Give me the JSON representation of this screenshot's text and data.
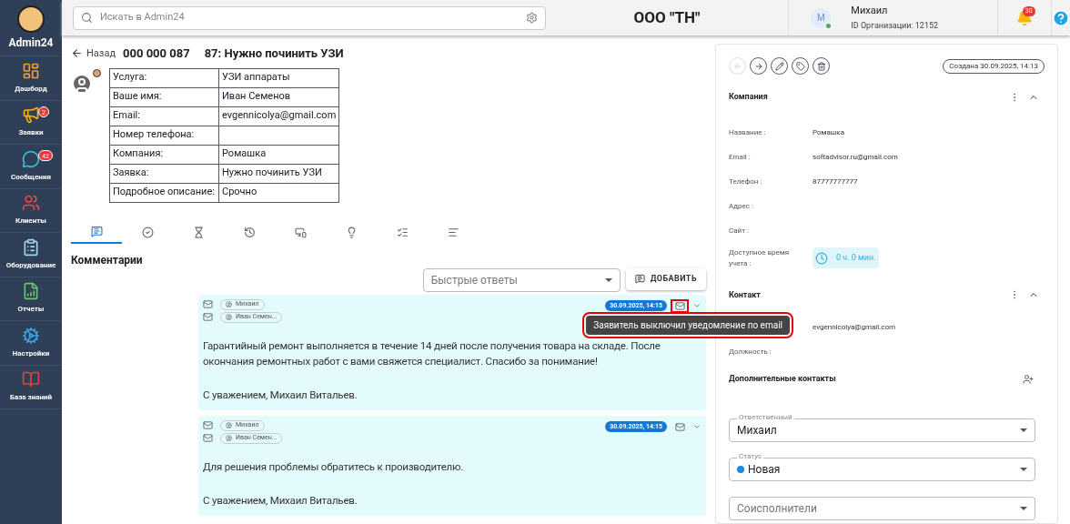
{
  "app": {
    "name": "Admin24"
  },
  "sidebar": {
    "items": [
      {
        "label": "Дашборд"
      },
      {
        "label": "Заявки",
        "badge": "2"
      },
      {
        "label": "Сообщения",
        "badge": "42"
      },
      {
        "label": "Клиенты"
      },
      {
        "label": "Оборудование"
      },
      {
        "label": "Отчеты"
      },
      {
        "label": "Настройки"
      },
      {
        "label": "База знаний"
      }
    ]
  },
  "header": {
    "search_placeholder": "Искать в Admin24",
    "org": "ООО \"ТН\"",
    "user": {
      "initial": "M",
      "name": "Михаил",
      "org_id": "ID Организации: 12152",
      "online": true
    },
    "notifications": "30"
  },
  "ticket": {
    "back": "Назад",
    "number": "000 000 087",
    "title": "87: Нужно починить УЗИ",
    "fields": [
      {
        "label": "Услуга:",
        "value": "УЗИ аппараты"
      },
      {
        "label": "Ваше имя:",
        "value": "Иван Семенов"
      },
      {
        "label": "Email:",
        "value": "evgennicolya@gmail.com"
      },
      {
        "label": "Номер телефона:"
      },
      {
        "label": "Компания:",
        "value": "Ромашка"
      },
      {
        "label": "Заявка:",
        "value": "Нужно починить УЗИ"
      },
      {
        "label": "Подробное описание:",
        "value": "Срочно"
      }
    ]
  },
  "tabs": [
    {
      "selected": true
    },
    {
      "selected": false
    },
    {
      "selected": false
    },
    {
      "selected": false
    },
    {
      "selected": false
    },
    {
      "selected": false
    },
    {
      "selected": false
    },
    {
      "selected": false
    }
  ],
  "comments_title": "Комментарии",
  "quick_replies": {
    "placeholder": "Быстрые ответы"
  },
  "add_button": "ДОБАВИТЬ",
  "comments": [
    {
      "from": "Михаил",
      "to": "Иван Семен...",
      "date": "30.09.2025, 14:15",
      "highlighted": true,
      "tooltip": "Заявитель выключил уведомление по email",
      "paragraphs": [
        "Гарантийный ремонт выполняется в течение 14 дней после получения товара на складе. После окончания ремонтных работ с вами свяжется специалист. Спасибо за понимание!",
        "С уважением, Михаил Витальев."
      ]
    },
    {
      "from": "Михаил",
      "to": "Иван Семен...",
      "date": "30.09.2025, 14:15",
      "highlighted": false,
      "paragraphs": [
        "Для решения проблемы обратитесь к производителю.",
        "С уважением, Михаил Витальев."
      ]
    }
  ],
  "panel": {
    "actions": [
      {
        "disabled": true
      },
      {
        "disabled": false
      },
      {
        "disabled": false
      },
      {
        "disabled": false
      },
      {
        "disabled": false
      }
    ],
    "created": "Создана 30.09.2025, 14:13",
    "company": {
      "title": "Компания",
      "fields": [
        {
          "label": "Название :",
          "value": "Ромашка"
        },
        {
          "label": "Email :",
          "value": "softadvisor.ru@gmail.com"
        },
        {
          "label": "Телефон :",
          "value": "87777777777"
        },
        {
          "label": "Адрес :"
        },
        {
          "label": "Сайт :"
        }
      ],
      "time_label": "Доступное время учета :",
      "time_value": "0 ч. 0 мин."
    },
    "contact": {
      "title": "Контакт",
      "email": "evgennicolya@gmail.com",
      "position_label": "Должность :"
    },
    "extra_contacts": "Дополнительные контакты",
    "assignee": {
      "label": "Ответственный",
      "value": "Михаил"
    },
    "status": {
      "label": "Статус",
      "value": "Новая",
      "color": "#1e88e5"
    },
    "coexecutors": {
      "placeholder": "Соисполнители"
    }
  }
}
